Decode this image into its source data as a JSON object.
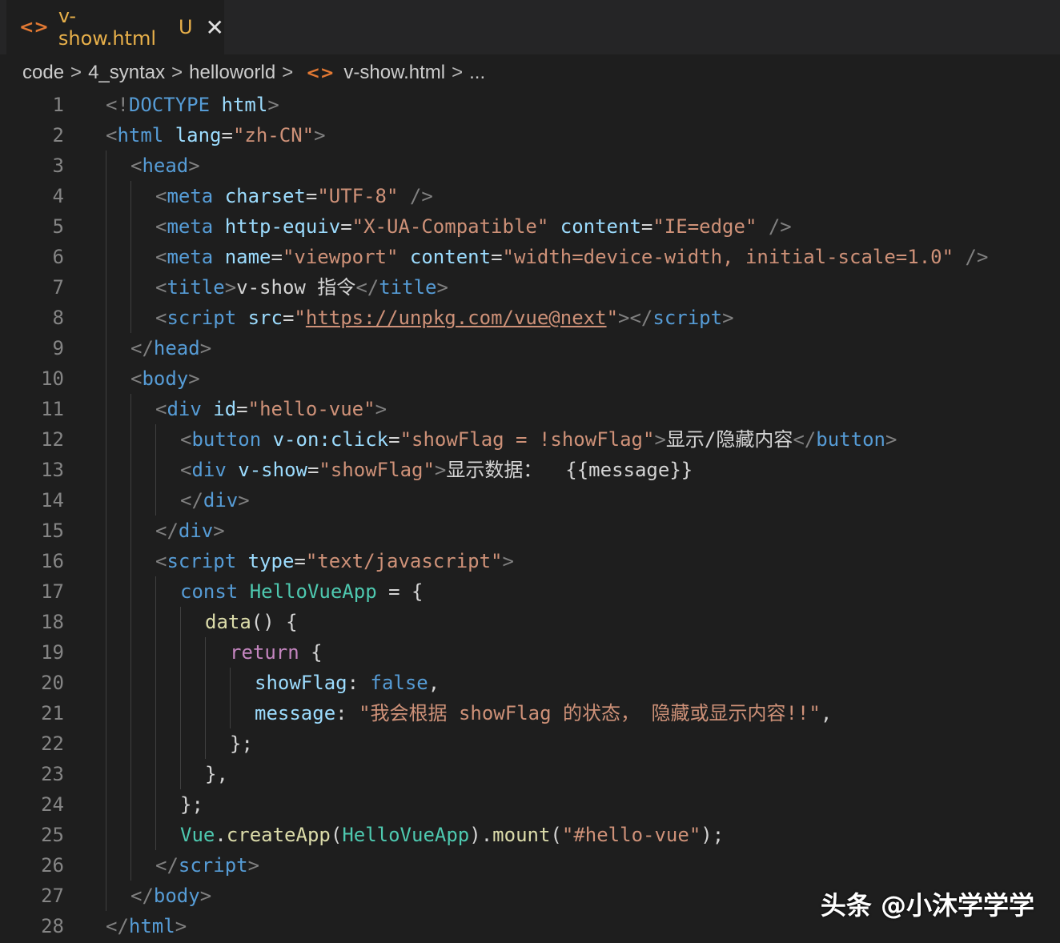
{
  "tab": {
    "filename": "v-show.html",
    "status": "U",
    "file_icon": "html-code-icon",
    "close_icon": "close-icon",
    "close_glyph": "✕",
    "icon_glyph": "<>"
  },
  "breadcrumb": {
    "items": [
      "code",
      "4_syntax",
      "helloworld",
      "v-show.html",
      "..."
    ],
    "separator": ">"
  },
  "colors": {
    "background": "#1e1e1e",
    "tag": "#569cd6",
    "attribute": "#9cdcfe",
    "string": "#ce9178",
    "control": "#c586c0",
    "class": "#4ec9b0",
    "function": "#dcdcaa",
    "line_number": "#858585"
  },
  "code_lines": [
    {
      "n": "1",
      "indent": 0,
      "tokens": [
        [
          "br",
          "<!"
        ],
        [
          "tag",
          "DOCTYPE"
        ],
        [
          "txt",
          " "
        ],
        [
          "attr",
          "html"
        ],
        [
          "br",
          ">"
        ]
      ]
    },
    {
      "n": "2",
      "indent": 0,
      "tokens": [
        [
          "br",
          "<"
        ],
        [
          "tag",
          "html"
        ],
        [
          "txt",
          " "
        ],
        [
          "attr",
          "lang"
        ],
        [
          "txt",
          "="
        ],
        [
          "str",
          "\"zh-CN\""
        ],
        [
          "br",
          ">"
        ]
      ]
    },
    {
      "n": "3",
      "indent": 1,
      "tokens": [
        [
          "br",
          "<"
        ],
        [
          "tag",
          "head"
        ],
        [
          "br",
          ">"
        ]
      ]
    },
    {
      "n": "4",
      "indent": 2,
      "tokens": [
        [
          "br",
          "<"
        ],
        [
          "tag",
          "meta"
        ],
        [
          "txt",
          " "
        ],
        [
          "attr",
          "charset"
        ],
        [
          "txt",
          "="
        ],
        [
          "str",
          "\"UTF-8\""
        ],
        [
          "txt",
          " "
        ],
        [
          "br",
          "/>"
        ]
      ]
    },
    {
      "n": "5",
      "indent": 2,
      "tokens": [
        [
          "br",
          "<"
        ],
        [
          "tag",
          "meta"
        ],
        [
          "txt",
          " "
        ],
        [
          "attr",
          "http-equiv"
        ],
        [
          "txt",
          "="
        ],
        [
          "str",
          "\"X-UA-Compatible\""
        ],
        [
          "txt",
          " "
        ],
        [
          "attr",
          "content"
        ],
        [
          "txt",
          "="
        ],
        [
          "str",
          "\"IE=edge\""
        ],
        [
          "txt",
          " "
        ],
        [
          "br",
          "/>"
        ]
      ]
    },
    {
      "n": "6",
      "indent": 2,
      "tokens": [
        [
          "br",
          "<"
        ],
        [
          "tag",
          "meta"
        ],
        [
          "txt",
          " "
        ],
        [
          "attr",
          "name"
        ],
        [
          "txt",
          "="
        ],
        [
          "str",
          "\"viewport\""
        ],
        [
          "txt",
          " "
        ],
        [
          "attr",
          "content"
        ],
        [
          "txt",
          "="
        ],
        [
          "str",
          "\"width=device-width, initial-scale=1.0\""
        ],
        [
          "txt",
          " "
        ],
        [
          "br",
          "/>"
        ]
      ]
    },
    {
      "n": "7",
      "indent": 2,
      "tokens": [
        [
          "br",
          "<"
        ],
        [
          "tag",
          "title"
        ],
        [
          "br",
          ">"
        ],
        [
          "txt",
          "v-show 指令"
        ],
        [
          "br",
          "</"
        ],
        [
          "tag",
          "title"
        ],
        [
          "br",
          ">"
        ]
      ]
    },
    {
      "n": "8",
      "indent": 2,
      "tokens": [
        [
          "br",
          "<"
        ],
        [
          "tag",
          "script"
        ],
        [
          "txt",
          " "
        ],
        [
          "attr",
          "src"
        ],
        [
          "txt",
          "="
        ],
        [
          "str",
          "\""
        ],
        [
          "url",
          "https://unpkg.com/vue@next"
        ],
        [
          "str",
          "\""
        ],
        [
          "br",
          "></"
        ],
        [
          "tag",
          "script"
        ],
        [
          "br",
          ">"
        ]
      ]
    },
    {
      "n": "9",
      "indent": 1,
      "tokens": [
        [
          "br",
          "</"
        ],
        [
          "tag",
          "head"
        ],
        [
          "br",
          ">"
        ]
      ]
    },
    {
      "n": "10",
      "indent": 1,
      "tokens": [
        [
          "br",
          "<"
        ],
        [
          "tag",
          "body"
        ],
        [
          "br",
          ">"
        ]
      ]
    },
    {
      "n": "11",
      "indent": 2,
      "tokens": [
        [
          "br",
          "<"
        ],
        [
          "tag",
          "div"
        ],
        [
          "txt",
          " "
        ],
        [
          "attr",
          "id"
        ],
        [
          "txt",
          "="
        ],
        [
          "str",
          "\"hello-vue\""
        ],
        [
          "br",
          ">"
        ]
      ]
    },
    {
      "n": "12",
      "indent": 3,
      "tokens": [
        [
          "br",
          "<"
        ],
        [
          "tag",
          "button"
        ],
        [
          "txt",
          " "
        ],
        [
          "attr",
          "v-on:click"
        ],
        [
          "txt",
          "="
        ],
        [
          "str",
          "\"showFlag = !showFlag\""
        ],
        [
          "br",
          ">"
        ],
        [
          "txt",
          "显示/隐藏内容"
        ],
        [
          "br",
          "</"
        ],
        [
          "tag",
          "button"
        ],
        [
          "br",
          ">"
        ]
      ]
    },
    {
      "n": "13",
      "indent": 3,
      "tokens": [
        [
          "br",
          "<"
        ],
        [
          "tag",
          "div"
        ],
        [
          "txt",
          " "
        ],
        [
          "attr",
          "v-show"
        ],
        [
          "txt",
          "="
        ],
        [
          "str",
          "\"showFlag\""
        ],
        [
          "br",
          ">"
        ],
        [
          "txt",
          "显示数据：  {{message}}"
        ]
      ]
    },
    {
      "n": "14",
      "indent": 3,
      "tokens": [
        [
          "br",
          "</"
        ],
        [
          "tag",
          "div"
        ],
        [
          "br",
          ">"
        ]
      ]
    },
    {
      "n": "15",
      "indent": 2,
      "tokens": [
        [
          "br",
          "</"
        ],
        [
          "tag",
          "div"
        ],
        [
          "br",
          ">"
        ]
      ]
    },
    {
      "n": "16",
      "indent": 2,
      "tokens": [
        [
          "br",
          "<"
        ],
        [
          "tag",
          "script"
        ],
        [
          "txt",
          " "
        ],
        [
          "attr",
          "type"
        ],
        [
          "txt",
          "="
        ],
        [
          "str",
          "\"text/javascript\""
        ],
        [
          "br",
          ">"
        ]
      ]
    },
    {
      "n": "17",
      "indent": 3,
      "tokens": [
        [
          "kw",
          "const"
        ],
        [
          "txt",
          " "
        ],
        [
          "cls",
          "HelloVueApp"
        ],
        [
          "txt",
          " = {"
        ]
      ]
    },
    {
      "n": "18",
      "indent": 4,
      "tokens": [
        [
          "fn",
          "data"
        ],
        [
          "txt",
          "() {"
        ]
      ]
    },
    {
      "n": "19",
      "indent": 5,
      "tokens": [
        [
          "ctrl",
          "return"
        ],
        [
          "txt",
          " {"
        ]
      ]
    },
    {
      "n": "20",
      "indent": 6,
      "tokens": [
        [
          "var",
          "showFlag"
        ],
        [
          "txt",
          ": "
        ],
        [
          "kw",
          "false"
        ],
        [
          "txt",
          ","
        ]
      ]
    },
    {
      "n": "21",
      "indent": 6,
      "tokens": [
        [
          "var",
          "message"
        ],
        [
          "txt",
          ": "
        ],
        [
          "str",
          "\"我会根据 showFlag 的状态， 隐藏或显示内容!!\""
        ],
        [
          "txt",
          ","
        ]
      ]
    },
    {
      "n": "22",
      "indent": 5,
      "tokens": [
        [
          "txt",
          "};"
        ]
      ]
    },
    {
      "n": "23",
      "indent": 4,
      "tokens": [
        [
          "txt",
          "},"
        ]
      ]
    },
    {
      "n": "24",
      "indent": 3,
      "tokens": [
        [
          "txt",
          "};"
        ]
      ]
    },
    {
      "n": "25",
      "indent": 3,
      "tokens": [
        [
          "cls",
          "Vue"
        ],
        [
          "txt",
          "."
        ],
        [
          "fn",
          "createApp"
        ],
        [
          "txt",
          "("
        ],
        [
          "cls",
          "HelloVueApp"
        ],
        [
          "txt",
          ")."
        ],
        [
          "fn",
          "mount"
        ],
        [
          "txt",
          "("
        ],
        [
          "str",
          "\"#hello-vue\""
        ],
        [
          "txt",
          ");"
        ]
      ]
    },
    {
      "n": "26",
      "indent": 2,
      "tokens": [
        [
          "br",
          "</"
        ],
        [
          "tag",
          "script"
        ],
        [
          "br",
          ">"
        ]
      ]
    },
    {
      "n": "27",
      "indent": 1,
      "tokens": [
        [
          "br",
          "</"
        ],
        [
          "tag",
          "body"
        ],
        [
          "br",
          ">"
        ]
      ]
    },
    {
      "n": "28",
      "indent": 0,
      "tokens": [
        [
          "br",
          "</"
        ],
        [
          "tag",
          "html"
        ],
        [
          "br",
          ">"
        ]
      ]
    }
  ],
  "watermark": "头条 @小沐学学学"
}
